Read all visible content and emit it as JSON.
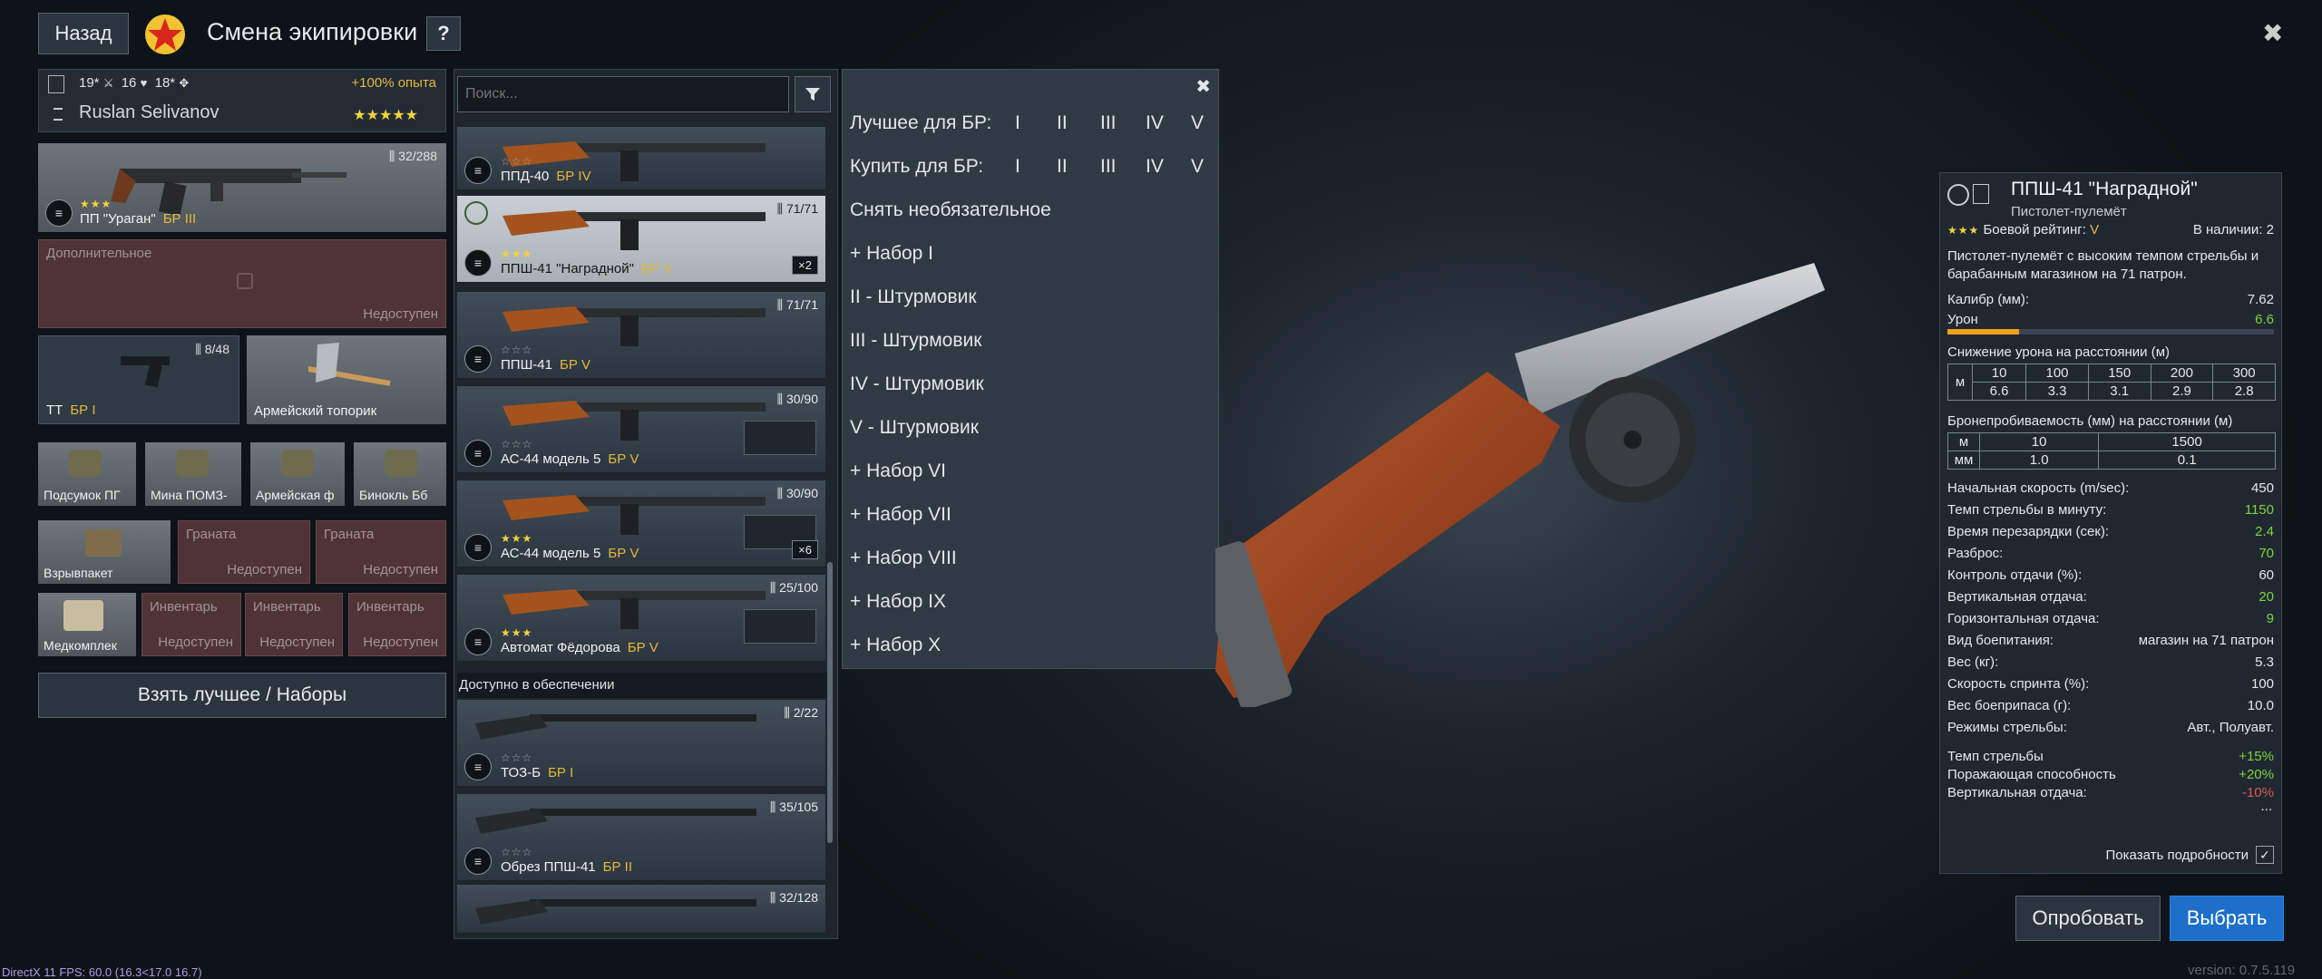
{
  "header": {
    "back_label": "Назад",
    "title": "Смена экипировки",
    "help_label": "?",
    "close_label": "✖"
  },
  "soldier": {
    "stat1": "19*",
    "stat2": "16",
    "stat3": "18*",
    "bonus": "+100% опыта",
    "name": "Ruslan Selivanov",
    "stars": "★★★★★"
  },
  "loadout": {
    "primary": {
      "name": "ПП \"Ураган\"",
      "br": "БР III",
      "ammo": "32/288",
      "stars": "★★★"
    },
    "secondary": {
      "head": "Дополнительное",
      "status": "Недоступен"
    },
    "pistol": {
      "name": "ТТ",
      "br": "БР I",
      "ammo": "8/48"
    },
    "melee": {
      "name": "Армейский топорик"
    },
    "items": [
      "Подсумок ПГ",
      "Мина ПОМЗ-",
      "Армейская ф",
      "Бинокль Бб"
    ],
    "grenade_main": "Взрывпакет",
    "grenade_slots": [
      {
        "head": "Граната",
        "status": "Недоступен"
      },
      {
        "head": "Граната",
        "status": "Недоступен"
      }
    ],
    "medkit": "Медкомплек",
    "inventory_slots": [
      {
        "head": "Инвентарь",
        "status": "Недоступен"
      },
      {
        "head": "Инвентарь",
        "status": "Недоступен"
      },
      {
        "head": "Инвентарь",
        "status": "Недоступен"
      }
    ],
    "best_button": "Взять лучшее / Наборы"
  },
  "search": {
    "placeholder": "Поиск..."
  },
  "weapons": [
    {
      "name": "ППД-40",
      "br": "БР IV",
      "ammo": "",
      "stars": "☆☆☆",
      "filled": ""
    },
    {
      "name": "ППШ-41 \"Наградной\"",
      "br": "БР V",
      "ammo": "71/71",
      "stars": "",
      "filled": "★★★",
      "mult": "×2"
    },
    {
      "name": "ППШ-41",
      "br": "БР V",
      "ammo": "71/71",
      "stars": "☆☆☆",
      "filled": ""
    },
    {
      "name": "АС-44 модель 5",
      "br": "БР V",
      "ammo": "30/90",
      "stars": "☆☆☆",
      "filled": ""
    },
    {
      "name": "АС-44 модель 5",
      "br": "БР V",
      "ammo": "30/90",
      "stars": "",
      "filled": "★★★",
      "mult": "×6"
    },
    {
      "name": "Автомат Фёдорова",
      "br": "БР V",
      "ammo": "25/100",
      "stars": "",
      "filled": "★★★"
    }
  ],
  "supply_header": "Доступно в обеспечении",
  "supply": [
    {
      "name": "ТОЗ-Б",
      "br": "БР I",
      "ammo": "2/22",
      "stars": "☆☆☆"
    },
    {
      "name": "Обрез ППШ-41",
      "br": "БР II",
      "ammo": "35/105",
      "stars": "☆☆☆"
    },
    {
      "name": "",
      "br": "",
      "ammo": "32/128",
      "stars": ""
    }
  ],
  "menu": {
    "close": "✖",
    "best_label": "Лучшее для БР:",
    "buy_label": "Купить для БР:",
    "ranks": [
      "I",
      "II",
      "III",
      "IV",
      "V"
    ],
    "items": [
      "Снять необязательное",
      "+ Набор I",
      "II - Штурмовик",
      "III - Штурмовик",
      "IV - Штурмовик",
      "V - Штурмовик",
      "+ Набор VI",
      "+ Набор VII",
      "+ Набор VIII",
      "+ Набор IX",
      "+ Набор X"
    ]
  },
  "details": {
    "name": "ППШ-41 \"Наградной\"",
    "type": "Пистолет-пулемёт",
    "stars": "★★★",
    "br_label": "Боевой рейтинг:",
    "br_value": "V",
    "stock": "В наличии: 2",
    "description": "Пистолет-пулемёт с высоким темпом стрельбы и барабанным магазином на 71 патрон.",
    "caliber_label": "Калибр (мм):",
    "caliber": "7.62",
    "damage_label": "Урон",
    "damage": "6.6",
    "damage_fill": 0.22,
    "falloff_label": "Снижение урона на расстоянии (м)",
    "falloff_unit": "м",
    "falloff_dist": [
      "10",
      "100",
      "150",
      "200",
      "300"
    ],
    "falloff_val": [
      "6.6",
      "3.3",
      "3.1",
      "2.9",
      "2.8"
    ],
    "pen_label": "Бронепробиваемость (мм) на расстоянии (м)",
    "pen_unit_m": "м",
    "pen_unit_mm": "мм",
    "pen_dist": [
      "10",
      "1500"
    ],
    "pen_val": [
      "1.0",
      "0.1"
    ],
    "rows": [
      {
        "label": "Начальная скорость (m/sec):",
        "value": "450",
        "color": ""
      },
      {
        "label": "Темп стрельбы в минуту:",
        "value": "1150",
        "color": "green"
      },
      {
        "label": "Время перезарядки (сек):",
        "value": "2.4",
        "color": "green"
      },
      {
        "label": "Разброс:",
        "value": "70",
        "color": "green"
      },
      {
        "label": "Контроль отдачи (%):",
        "value": "60",
        "color": ""
      },
      {
        "label": "Вертикальная отдача:",
        "value": "20",
        "color": "green"
      },
      {
        "label": "Горизонтальная отдача:",
        "value": "9",
        "color": "green"
      },
      {
        "label": "Вид боепитания:",
        "value": "магазин на 71 патрон",
        "color": ""
      },
      {
        "label": "Вес (кг):",
        "value": "5.3",
        "color": ""
      },
      {
        "label": "Скорость спринта (%):",
        "value": "100",
        "color": ""
      },
      {
        "label": "Вес боеприпаса (г):",
        "value": "10.0",
        "color": ""
      },
      {
        "label": "Режимы стрельбы:",
        "value": "Авт., Полуавт.",
        "color": ""
      }
    ],
    "mods": [
      {
        "label": "Темп стрельбы",
        "value": "+15%",
        "color": "green"
      },
      {
        "label": "Поражающая способность",
        "value": "+20%",
        "color": "green"
      },
      {
        "label": "Вертикальная отдача:",
        "value": "-10%",
        "color": "red"
      }
    ],
    "more": "...",
    "show_details": "Показать подробности"
  },
  "actions": {
    "try_label": "Опробовать",
    "select_label": "Выбрать"
  },
  "footer": {
    "fps": "DirectX 11 FPS: 60.0 (16.3<17.0 16.7)",
    "version": "version: 0.7.5.119"
  }
}
